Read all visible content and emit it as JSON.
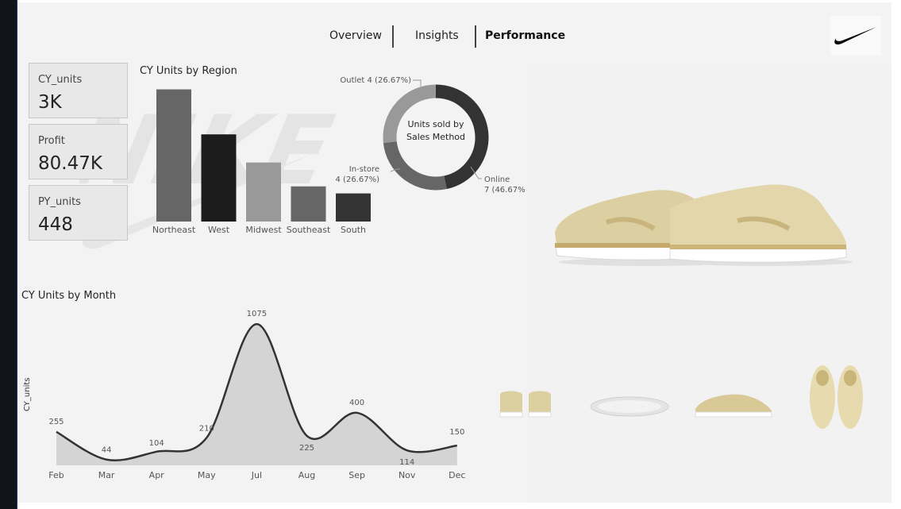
{
  "nav": {
    "tabs": [
      {
        "label": "Overview",
        "active": false
      },
      {
        "label": "Insights",
        "active": false
      },
      {
        "label": "Performance",
        "active": true
      }
    ]
  },
  "brand": {
    "logo_icon": "nike-swoosh-icon"
  },
  "kpis": [
    {
      "label": "CY_units",
      "value": "3K"
    },
    {
      "label": "Profit",
      "value": "80.47K"
    },
    {
      "label": "PY_units",
      "value": "448"
    }
  ],
  "colors": {
    "canvas": "#f3f3f3",
    "bar_dark": "#1c1c1c",
    "bar_mid": "#666666",
    "bar_light": "#999999",
    "donut_online": "#333333",
    "donut_outlet": "#999999",
    "donut_instore": "#666666",
    "area_fill": "#d4d4d4",
    "line": "#333333"
  },
  "chart_data": [
    {
      "type": "bar",
      "title": "CY Units by Region",
      "categories": [
        "Northeast",
        "West",
        "Midwest",
        "Southeast",
        "South"
      ],
      "values": [
        470,
        310,
        210,
        125,
        100
      ],
      "colors": [
        "#666666",
        "#1c1c1c",
        "#999999",
        "#666666",
        "#333333"
      ],
      "ylim": [
        0,
        480
      ],
      "grid": false
    },
    {
      "type": "pie",
      "variant": "donut",
      "center_label": [
        "Units sold by",
        "Sales Method"
      ],
      "slices": [
        {
          "label": "Online",
          "value": 7,
          "pct_label": "7 (46.67%)",
          "color": "#333333"
        },
        {
          "label": "In-store",
          "value": 4,
          "pct_label": "4 (26.67%)",
          "color": "#666666"
        },
        {
          "label": "Outlet",
          "value": 4,
          "pct_label": "Outlet 4 (26.67%)",
          "color": "#999999"
        }
      ]
    },
    {
      "type": "area",
      "title": "CY Units by Month",
      "ylabel": "CY_units",
      "categories": [
        "Feb",
        "Mar",
        "Apr",
        "May",
        "Jul",
        "Aug",
        "Sep",
        "Nov",
        "Dec"
      ],
      "values": [
        255,
        44,
        104,
        210,
        1075,
        225,
        400,
        114,
        150
      ],
      "ylim": [
        0,
        1100
      ],
      "grid": false
    }
  ]
}
